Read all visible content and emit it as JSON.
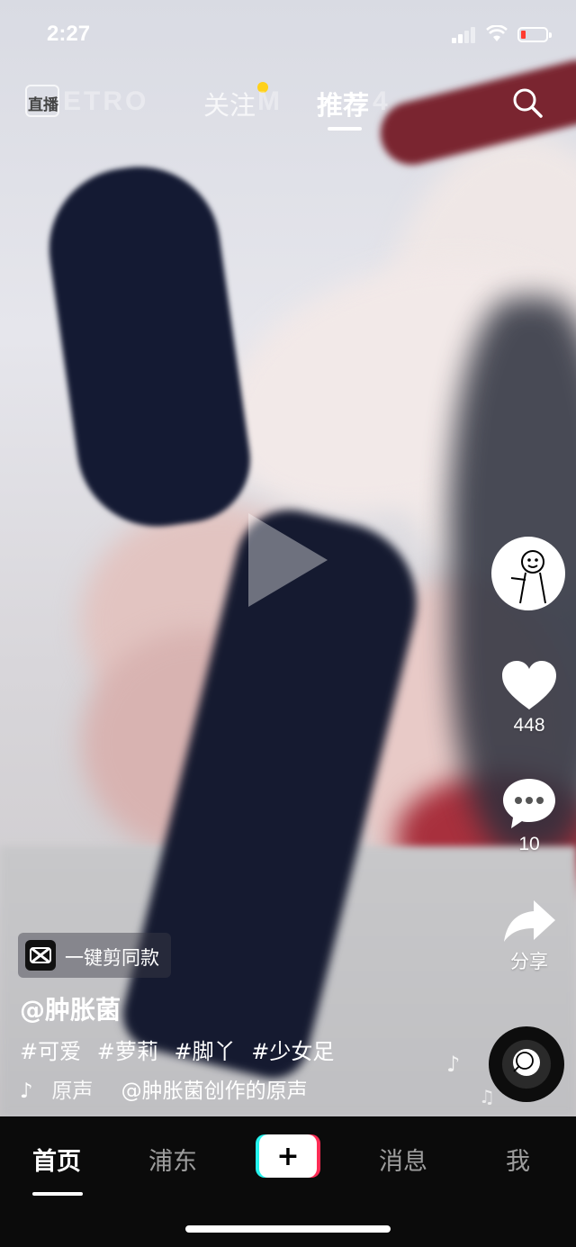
{
  "status_bar": {
    "time": "2:27"
  },
  "top_nav": {
    "live_label": "直播",
    "ghost_left": "ETRO",
    "ghost_mid": "M",
    "ghost_right": "4",
    "follow_tab": "关注",
    "recommend_tab": "推荐"
  },
  "video": {
    "state": "paused"
  },
  "right_rail": {
    "like_count": "448",
    "comment_count": "10",
    "share_label": "分享"
  },
  "caption": {
    "capcut_label": "一键剪同款",
    "author": "@肿胀菌",
    "hashtags": [
      "#可爱",
      "#萝莉",
      "#脚丫",
      "#少女足"
    ],
    "music_left": "原声",
    "music_right": "@肿胀菌创作的原声"
  },
  "bottom_nav": {
    "home": "首页",
    "pudong": "浦东",
    "create": "+",
    "messages": "消息",
    "me": "我"
  },
  "colors": {
    "accent_yellow": "#ffd11a",
    "tiktok_cyan": "#25f4ee",
    "tiktok_red": "#fe2c55",
    "battery_low": "#ff3b30"
  }
}
